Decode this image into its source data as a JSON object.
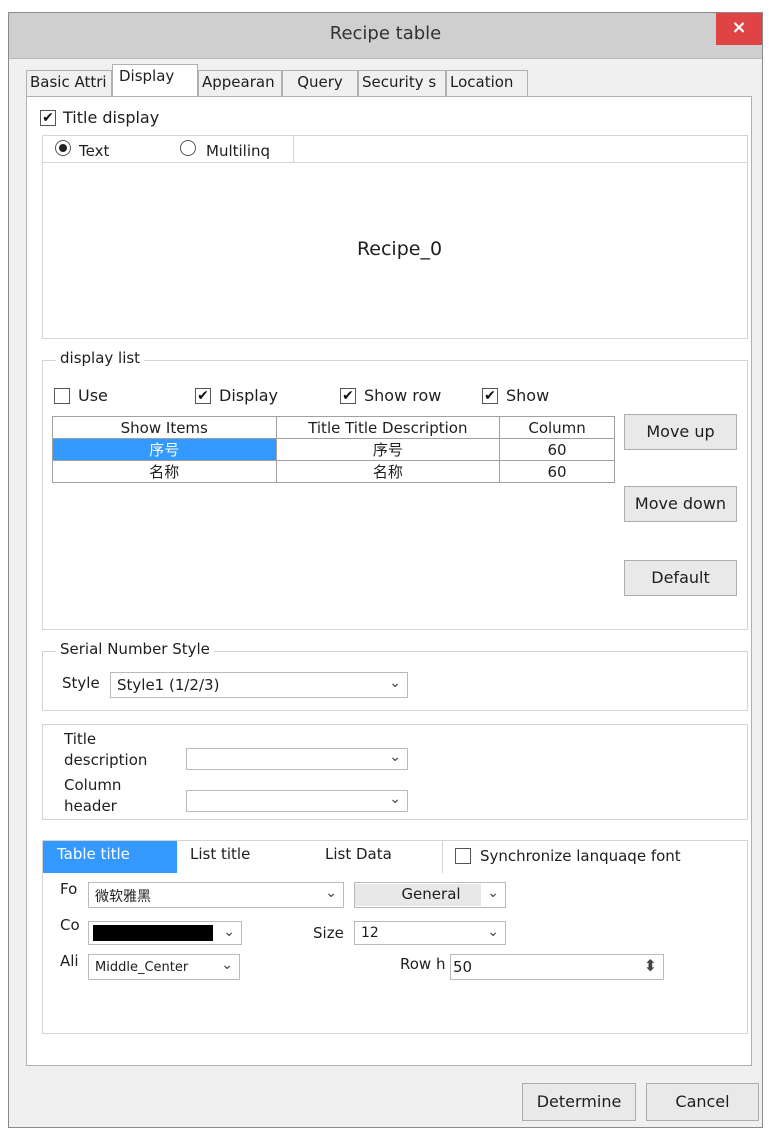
{
  "window": {
    "title": "Recipe table",
    "close_label": "×"
  },
  "tabs": [
    {
      "label": "Basic Attri"
    },
    {
      "label": "Display"
    },
    {
      "label": "Appearan"
    },
    {
      "label": "Query"
    },
    {
      "label": "Security s"
    },
    {
      "label": "Location"
    }
  ],
  "title_section": {
    "checkbox_label": "Title display",
    "checkbox_mark": "✔",
    "radio_text": "Text",
    "radio_multi": "Multilinq",
    "preview_text": "Recipe_0"
  },
  "display_list": {
    "legend": "display list",
    "use_label": "Use",
    "display_label": "Display",
    "show_row_label": "Show row",
    "show_label": "Show",
    "check_mark": "✔",
    "columns": [
      "Show Items",
      "Title  Title Description",
      "Column"
    ],
    "rows": [
      {
        "item": "序号",
        "description": "序号",
        "width": "60"
      },
      {
        "item": "名称",
        "description": "名称",
        "width": "60"
      }
    ],
    "move_up": "Move up",
    "move_down": "Move down",
    "default": "Default"
  },
  "serial": {
    "legend": "Serial Number Style",
    "style_label": "Style",
    "style_value": "Style1 (1/2/3)",
    "arrow": "⌄"
  },
  "headers": {
    "title_description_line1": "Title",
    "title_description_line2": "description",
    "column_header_line1": "Column",
    "column_header_line2": "header",
    "arrow": "⌄"
  },
  "font_section": {
    "tabs": [
      "Table title",
      "List title",
      "List Data"
    ],
    "sync_label": "Synchronize lanquaqe font",
    "font_label": "Fo",
    "font_value": "微软雅黑",
    "style_value": "General",
    "color_label": "Co",
    "color_value": "#000000",
    "size_label": "Size",
    "size_value": "12",
    "align_label": "Ali",
    "align_value": "Middle_Center",
    "row_height_label": "Row h",
    "row_height_value": "50",
    "arrow": "⌄",
    "spin": "⬍"
  },
  "footer": {
    "ok_label": "Determine",
    "cancel_label": "Cancel"
  }
}
